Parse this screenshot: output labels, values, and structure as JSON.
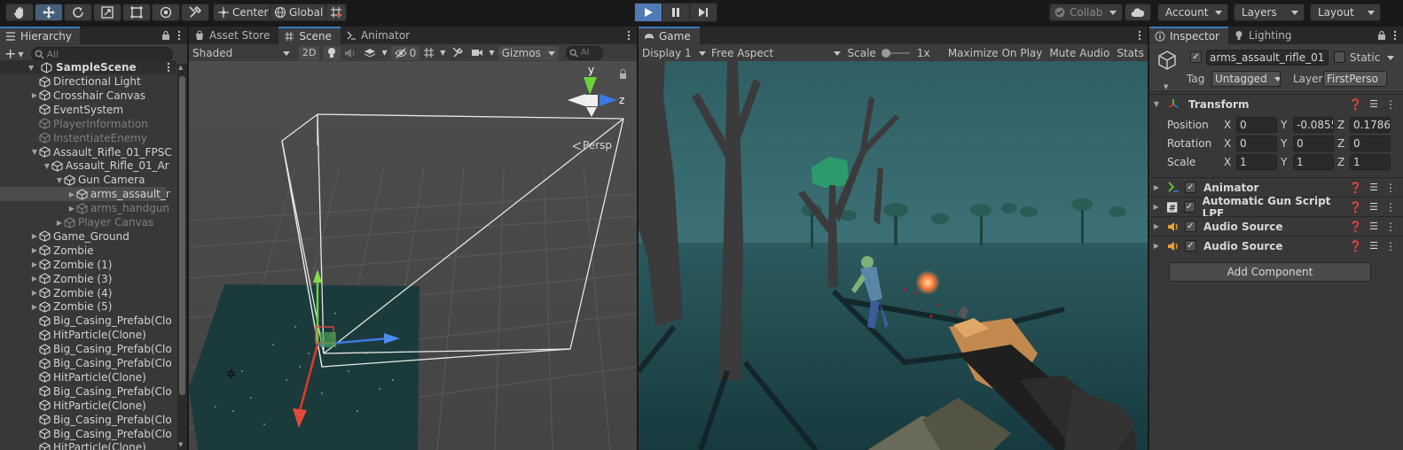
{
  "toolbar": {
    "tools": [
      "hand-tool-icon",
      "move-tool-icon",
      "rotate-tool-icon",
      "scale-tool-icon",
      "rect-tool-icon",
      "transform-tool-icon",
      "custom-tool-icon"
    ],
    "pivot_label": "Center",
    "space_label": "Global",
    "collab_label": "Collab",
    "account_label": "Account",
    "layers_label": "Layers",
    "layout_label": "Layout"
  },
  "hierarchy": {
    "tab": "Hierarchy",
    "search_placeholder": "All",
    "scene": "SampleScene",
    "items": [
      {
        "label": "Directional Light",
        "indent": 1,
        "arrow": "",
        "dim": false,
        "sel": false
      },
      {
        "label": "Crosshair Canvas",
        "indent": 1,
        "arrow": "r",
        "dim": false,
        "sel": false
      },
      {
        "label": "EventSystem",
        "indent": 1,
        "arrow": "",
        "dim": false,
        "sel": false
      },
      {
        "label": "PlayerInformation",
        "indent": 1,
        "arrow": "",
        "dim": true,
        "sel": false
      },
      {
        "label": "InstentiateEnemy",
        "indent": 1,
        "arrow": "",
        "dim": true,
        "sel": false
      },
      {
        "label": "Assault_Rifle_01_FPSC",
        "indent": 1,
        "arrow": "d",
        "dim": false,
        "sel": false
      },
      {
        "label": "Assault_Rifle_01_Ar",
        "indent": 2,
        "arrow": "d",
        "dim": false,
        "sel": false
      },
      {
        "label": "Gun Camera",
        "indent": 3,
        "arrow": "d",
        "dim": false,
        "sel": false
      },
      {
        "label": "arms_assault_r",
        "indent": 4,
        "arrow": "r",
        "dim": false,
        "sel": true
      },
      {
        "label": "arms_handgun",
        "indent": 4,
        "arrow": "r",
        "dim": true,
        "sel": false
      },
      {
        "label": "Player Canvas",
        "indent": 3,
        "arrow": "r",
        "dim": true,
        "sel": false
      },
      {
        "label": "Game_Ground",
        "indent": 1,
        "arrow": "r",
        "dim": false,
        "sel": false
      },
      {
        "label": "Zombie",
        "indent": 1,
        "arrow": "r",
        "dim": false,
        "sel": false
      },
      {
        "label": "Zombie (1)",
        "indent": 1,
        "arrow": "r",
        "dim": false,
        "sel": false
      },
      {
        "label": "Zombie (3)",
        "indent": 1,
        "arrow": "r",
        "dim": false,
        "sel": false
      },
      {
        "label": "Zombie (4)",
        "indent": 1,
        "arrow": "r",
        "dim": false,
        "sel": false
      },
      {
        "label": "Zombie (5)",
        "indent": 1,
        "arrow": "r",
        "dim": false,
        "sel": false
      },
      {
        "label": "Big_Casing_Prefab(Clo",
        "indent": 1,
        "arrow": "",
        "dim": false,
        "sel": false
      },
      {
        "label": "HitParticle(Clone)",
        "indent": 1,
        "arrow": "",
        "dim": false,
        "sel": false
      },
      {
        "label": "Big_Casing_Prefab(Clo",
        "indent": 1,
        "arrow": "",
        "dim": false,
        "sel": false
      },
      {
        "label": "Big_Casing_Prefab(Clo",
        "indent": 1,
        "arrow": "",
        "dim": false,
        "sel": false
      },
      {
        "label": "HitParticle(Clone)",
        "indent": 1,
        "arrow": "",
        "dim": false,
        "sel": false
      },
      {
        "label": "Big_Casing_Prefab(Clo",
        "indent": 1,
        "arrow": "",
        "dim": false,
        "sel": false
      },
      {
        "label": "HitParticle(Clone)",
        "indent": 1,
        "arrow": "",
        "dim": false,
        "sel": false
      },
      {
        "label": "Big_Casing_Prefab(Clo",
        "indent": 1,
        "arrow": "",
        "dim": false,
        "sel": false
      },
      {
        "label": "Big_Casing_Prefab(Clo",
        "indent": 1,
        "arrow": "",
        "dim": false,
        "sel": false
      },
      {
        "label": "HitParticle(Clone)",
        "indent": 1,
        "arrow": "",
        "dim": false,
        "sel": false
      }
    ]
  },
  "scene": {
    "tabs": [
      "Asset Store",
      "Scene",
      "Animator"
    ],
    "shading": "Shaded",
    "mode2d": "2D",
    "hidden_count": "0",
    "gizmos": "Gizmos",
    "search_placeholder": "Al",
    "gizmo_y": "y",
    "gizmo_z": "z",
    "persp": "Persp"
  },
  "game": {
    "tab": "Game",
    "display": "Display 1",
    "aspect": "Free Aspect",
    "scale_label": "Scale",
    "scale_value": "1x",
    "maximize": "Maximize On Play",
    "mute": "Mute Audio",
    "stats": "Stats"
  },
  "inspector": {
    "tabs": [
      "Inspector",
      "Lighting"
    ],
    "object_name": "arms_assault_rifle_01",
    "static_label": "Static",
    "tag_label": "Tag",
    "tag_value": "Untagged",
    "layer_label": "Layer",
    "layer_value": "FirstPerso",
    "transform": {
      "title": "Transform",
      "rows": [
        {
          "label": "Position",
          "x": "0",
          "y": "-0.0855",
          "z": "0.17866"
        },
        {
          "label": "Rotation",
          "x": "0",
          "y": "0",
          "z": "0"
        },
        {
          "label": "Scale",
          "x": "1",
          "y": "1",
          "z": "1"
        }
      ],
      "axis_x": "X",
      "axis_y": "Y",
      "axis_z": "Z"
    },
    "components": [
      {
        "name": "Animator",
        "icon": "animator-icon"
      },
      {
        "name": "Automatic Gun Script LPF",
        "icon": "script-icon"
      },
      {
        "name": "Audio Source",
        "icon": "audio-source-icon"
      },
      {
        "name": "Audio Source",
        "icon": "audio-source-icon"
      }
    ],
    "add_component": "Add Component"
  },
  "colors": {
    "accent": "#3a79bb",
    "play_active": "#4e7bb3",
    "selection": "#4d4d4d",
    "panel": "#383838",
    "ground": "#1b3a3c"
  }
}
